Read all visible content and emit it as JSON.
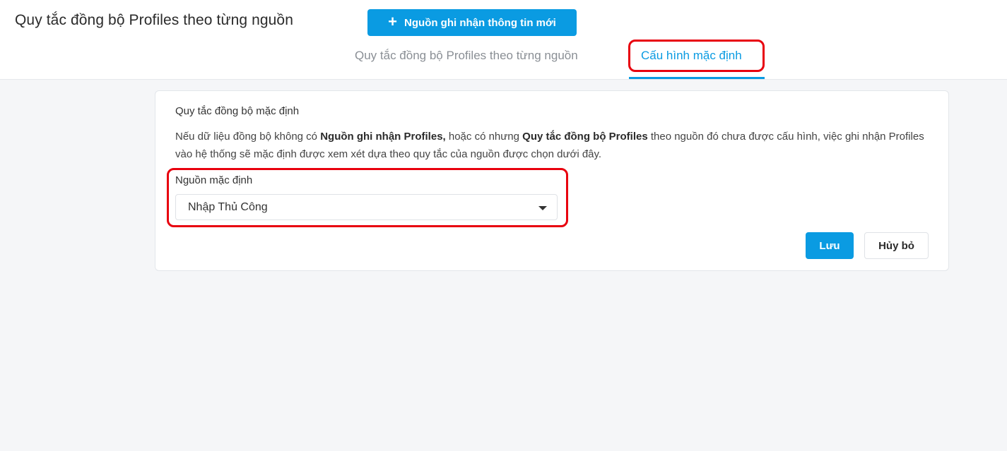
{
  "header": {
    "title": "Quy tắc đồng bộ Profiles theo từng nguồn",
    "new_source_button": {
      "icon": "plus-icon",
      "label": "Nguồn ghi nhận thông tin mới"
    }
  },
  "tabs": [
    {
      "label": "Quy tắc đồng bộ Profiles theo từng nguồn",
      "active": false
    },
    {
      "label": "Cấu hình mặc định",
      "active": true
    }
  ],
  "card": {
    "title": "Quy tắc đồng bộ mặc định",
    "description": {
      "part1": "Nếu dữ liệu đồng bộ không có ",
      "bold1": "Nguồn ghi nhận Profiles,",
      "part2": " hoặc có nhưng ",
      "bold2": "Quy tắc đồng bộ Profiles",
      "part3": " theo nguồn đó chưa được cấu hình, việc ghi nhận Profiles vào hệ thống sẽ mặc định được xem xét dựa theo quy tắc của nguồn được chọn dưới đây."
    },
    "default_source": {
      "label": "Nguồn mặc định",
      "selected_value": "Nhập Thủ Công",
      "icon": "caret-down-icon"
    },
    "save_label": "Lưu",
    "cancel_label": "Hủy bỏ"
  },
  "colors": {
    "accent": "#0a9be2",
    "highlight": "#e8000e",
    "background": "#f5f6f8"
  }
}
